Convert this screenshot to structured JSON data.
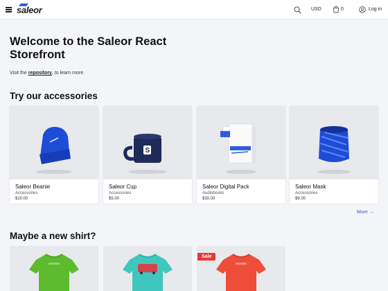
{
  "nav": {
    "brand": "saleor",
    "currency": "USD",
    "cart_count": "0",
    "login": "Log in",
    "icons": [
      "menu-icon",
      "search-icon",
      "shopping-bag-icon",
      "user-icon"
    ]
  },
  "hero": {
    "title": "Welcome to the Saleor React Storefront",
    "sub_before": "Visit the ",
    "sub_link": "repository",
    "sub_after": ", to learn more."
  },
  "accessories": {
    "title": "Try our accessories",
    "more": "More →",
    "products": [
      {
        "name": "Saleor Beanie",
        "category": "Accessories",
        "price": "$10.00"
      },
      {
        "name": "Saleor Cup",
        "category": "Accessories",
        "price": "$5.00"
      },
      {
        "name": "Saleor Digital Pack",
        "category": "Audiobooks",
        "price": "$30.00"
      },
      {
        "name": "Saleor Mask",
        "category": "Accessories",
        "price": "$6.00"
      }
    ]
  },
  "shirts": {
    "title": "Maybe a new shirt?",
    "sale_badge": "Sale",
    "colors": [
      "#5cbb2f",
      "#3fc6be",
      "#ee4d3a"
    ]
  },
  "colors": {
    "accent": "#2f5dd8",
    "background": "#f4f5f8",
    "sale": "#e63a35",
    "product_blue": "#1d4cd6"
  }
}
